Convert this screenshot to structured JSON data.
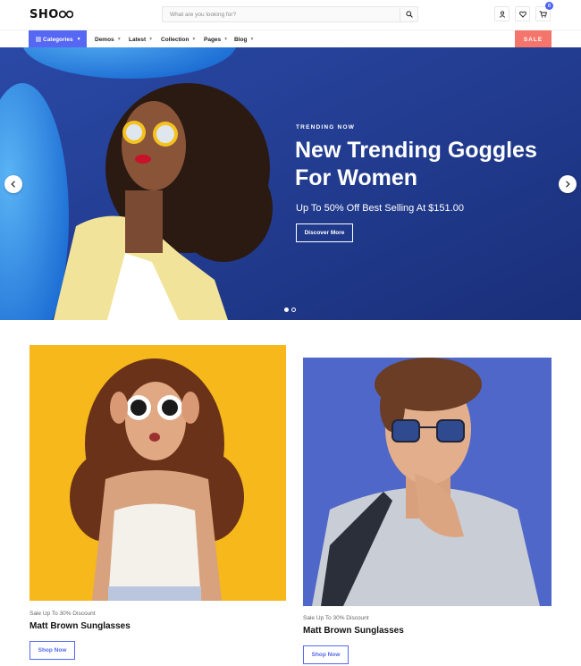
{
  "header": {
    "logo": "SHO",
    "search_placeholder": "What are you looking for?",
    "cart_count": "0"
  },
  "nav": {
    "categories_label": "Categories",
    "items": [
      {
        "label": "Demos"
      },
      {
        "label": "Latest"
      },
      {
        "label": "Collection"
      },
      {
        "label": "Pages"
      },
      {
        "label": "Blog"
      }
    ],
    "sale_label": "SALE"
  },
  "hero": {
    "eyebrow": "TRENDING NOW",
    "title": "New Trending Goggles For Women",
    "subtitle": "Up To 50% Off Best Selling At $151.00",
    "cta": "Discover More"
  },
  "products": [
    {
      "caption": "Sale Up To 30% Discount",
      "title": "Matt Brown Sunglasses",
      "cta": "Shop Now",
      "bg": "#f7b81b"
    },
    {
      "caption": "Sale Up To 30% Discount",
      "title": "Matt Brown Sunglasses",
      "cta": "Shop Now",
      "bg": "#4f67c8"
    }
  ],
  "colors": {
    "accent": "#5567f3",
    "sale": "#f4756c",
    "hero_bg": "#1c3a8a"
  }
}
